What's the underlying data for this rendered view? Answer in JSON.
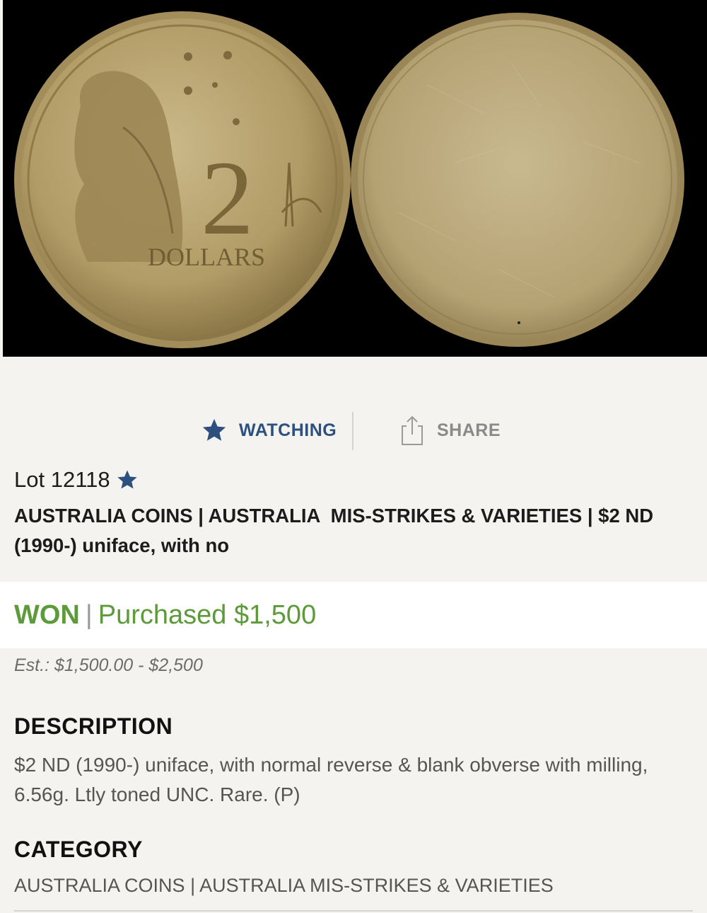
{
  "image": {
    "coin_text": "DOLLARS",
    "denomination": "2",
    "background_color": "#000000",
    "coin_color": "#b9a474"
  },
  "actions": {
    "watch_label": "WATCHING",
    "watch_icon": "star-icon",
    "share_label": "SHARE",
    "share_icon": "share-icon"
  },
  "lot": {
    "label": "Lot 12118",
    "title": "AUSTRALIA COINS | AUSTRALIA  MIS-STRIKES & VARIETIES | $2 ND (1990-) uniface, with no"
  },
  "result": {
    "status": "WON",
    "separator": "|",
    "purchased": "Purchased $1,500",
    "status_color": "#5c9a3a"
  },
  "estimate": "Est.: $1,500.00 - $2,500",
  "description": {
    "heading": "DESCRIPTION",
    "body": "$2 ND (1990-) uniface, with normal reverse & blank obverse with milling, 6.56g. Ltly toned UNC. Rare. (P)"
  },
  "category": {
    "heading": "CATEGORY",
    "body": "AUSTRALIA COINS | AUSTRALIA MIS-STRIKES & VARIETIES"
  },
  "colors": {
    "accent_blue": "#2d5080",
    "won_green": "#5c9a3a",
    "page_bg": "#f4f3ef"
  }
}
